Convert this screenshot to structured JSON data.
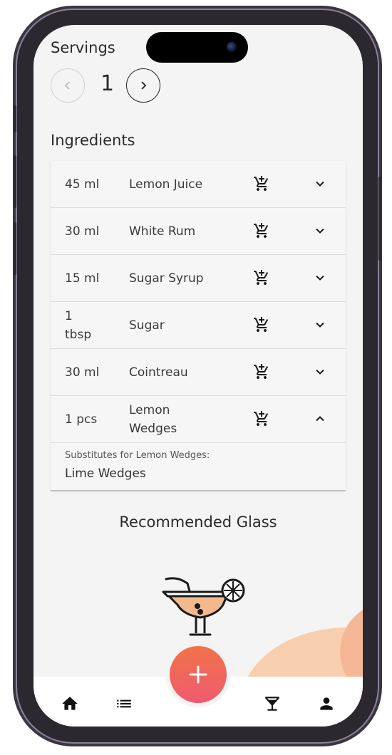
{
  "servings": {
    "label": "Servings",
    "value": "1",
    "prev_icon": "chevron-left-icon",
    "next_icon": "chevron-right-icon"
  },
  "ingredients": {
    "title": "Ingredients",
    "items": [
      {
        "amount": "45 ml",
        "name": "Lemon Juice",
        "expanded": false
      },
      {
        "amount": "30 ml",
        "name": "White Rum",
        "expanded": false
      },
      {
        "amount": "15 ml",
        "name": "Sugar Syrup",
        "expanded": false
      },
      {
        "amount": "1 tbsp",
        "name": "Sugar",
        "expanded": false
      },
      {
        "amount": "30 ml",
        "name": "Cointreau",
        "expanded": false
      },
      {
        "amount": "1 pcs",
        "name": "Lemon Wedges",
        "expanded": true
      }
    ],
    "substitute": {
      "label": "Substitutes for Lemon Wedges:",
      "value": "Lime Wedges"
    },
    "cart_icon": "add-to-cart-icon"
  },
  "glass": {
    "title": "Recommended Glass",
    "icon": "margarita-glass-icon"
  },
  "nav": {
    "items": [
      "home-icon",
      "list-icon",
      "cocktail-icon",
      "person-icon"
    ],
    "fab_icon": "plus-icon"
  },
  "colors": {
    "accent_start": "#f17249",
    "accent_end": "#ef5b6f",
    "blob": "#f8cfae",
    "background": "#f4f4f4"
  }
}
